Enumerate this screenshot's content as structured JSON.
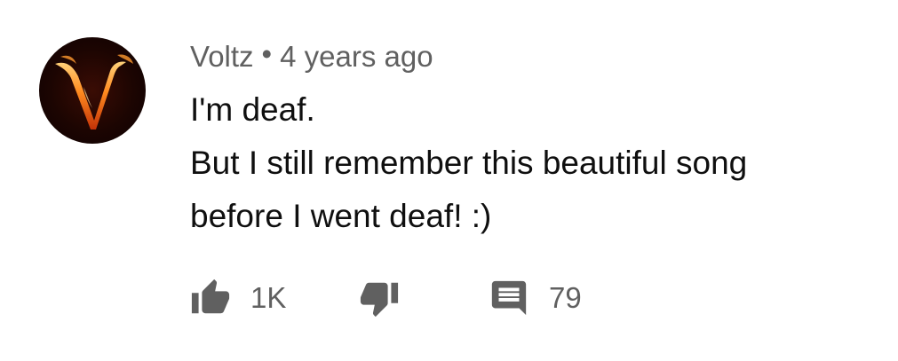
{
  "comment": {
    "author": "Voltz",
    "separator": "•",
    "timestamp": "4 years ago",
    "text_lines": [
      "I'm deaf.",
      "But I still remember this beautiful song",
      "before I went deaf! :)"
    ],
    "avatar": {
      "icon": "flaming-v-logo",
      "bg_color": "#1c0502",
      "accent_color": "#ff7a1a"
    },
    "actions": {
      "like_icon": "thumbs-up-icon",
      "like_count": "1K",
      "dislike_icon": "thumbs-down-icon",
      "reply_icon": "comment-icon",
      "reply_count": "79"
    },
    "colors": {
      "text": "#0f0f0f",
      "secondary_text": "#606060",
      "icon": "#606060"
    }
  }
}
